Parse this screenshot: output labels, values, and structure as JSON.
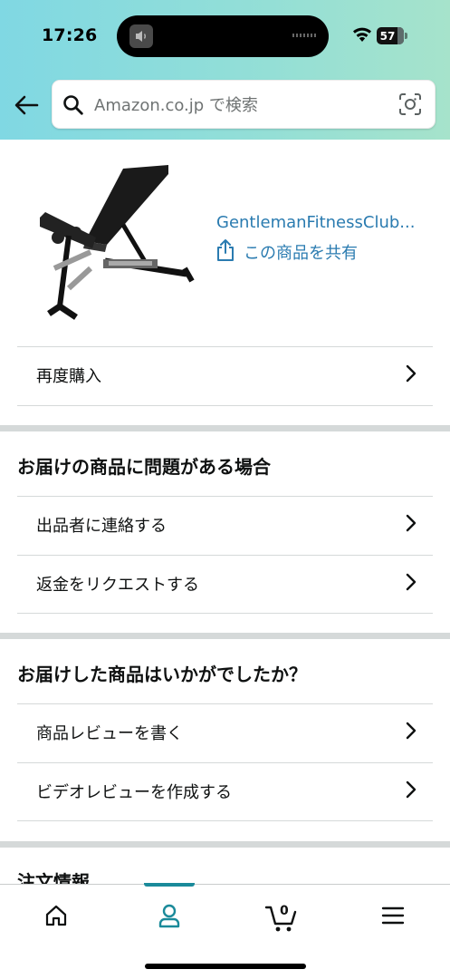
{
  "status_bar": {
    "time": "17:26",
    "battery": "57"
  },
  "search": {
    "placeholder": "Amazon.co.jp で検索",
    "value": ""
  },
  "product": {
    "title": "GentlemanFitnessClub...",
    "share_label": "この商品を共有"
  },
  "rebuy": {
    "label": "再度購入"
  },
  "problem_section": {
    "title": "お届けの商品に問題がある場合",
    "items": [
      {
        "label": "出品者に連絡する"
      },
      {
        "label": "返金をリクエストする"
      }
    ]
  },
  "feedback_section": {
    "title": "お届けした商品はいかがでしたか？",
    "items": [
      {
        "label": "商品レビューを書く"
      },
      {
        "label": "ビデオレビューを作成する"
      }
    ]
  },
  "order_info": {
    "title": "注文情報"
  },
  "bottom_nav": {
    "items": [
      {
        "icon": "home-icon"
      },
      {
        "icon": "account-icon",
        "active": true
      },
      {
        "icon": "cart-icon",
        "count": "0"
      },
      {
        "icon": "menu-icon"
      }
    ]
  },
  "colors": {
    "header_gradient_start": "#80d8e3",
    "header_gradient_end": "#a6e3cb",
    "link": "#2a7bb0",
    "active_nav": "#1a8a9a"
  }
}
